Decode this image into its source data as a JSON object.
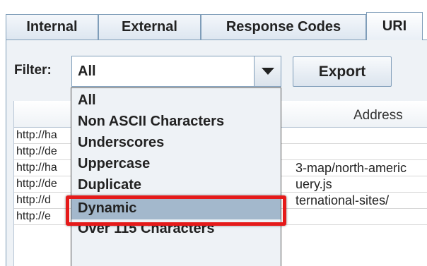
{
  "tabs": [
    {
      "label": "Internal",
      "active": false
    },
    {
      "label": "External",
      "active": false
    },
    {
      "label": "Response Codes",
      "active": false
    },
    {
      "label": "URI",
      "active": true
    }
  ],
  "filter": {
    "label": "Filter:",
    "selected": "All",
    "options": [
      "All",
      "Non ASCII Characters",
      "Underscores",
      "Uppercase",
      "Duplicate",
      "Dynamic",
      "Over 115 Characters"
    ],
    "highlighted_option": "Dynamic"
  },
  "export_label": "Export",
  "table": {
    "columns": [
      "",
      "Address"
    ],
    "rows": [
      {
        "url": "http://ha",
        "address": ""
      },
      {
        "url": "http://de",
        "address": ""
      },
      {
        "url": "http://ha",
        "address": "3-map/north-americ"
      },
      {
        "url": "http://de",
        "address": "uery.js"
      },
      {
        "url": "http://d",
        "address": "ternational-sites/"
      },
      {
        "url": "http://e",
        "address": ""
      }
    ]
  },
  "colors": {
    "highlight_border": "#e51a1a",
    "selected_option_bg": "#a3b8cc",
    "panel_bg": "#eef2f6"
  },
  "icons": {
    "combo_arrow": "triangle-down-icon"
  }
}
